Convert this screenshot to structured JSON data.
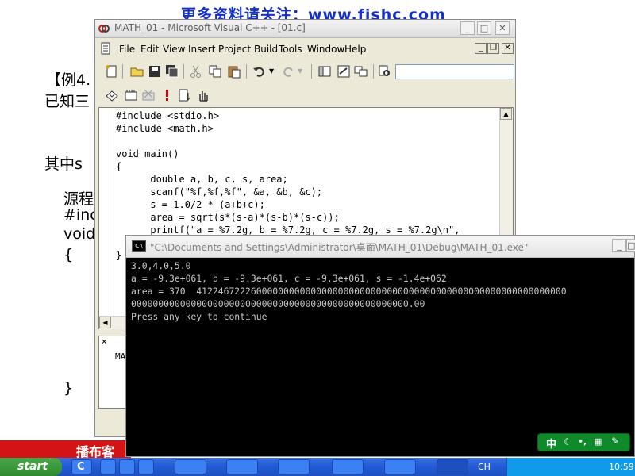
{
  "background_slide": {
    "header": "更多资料请关注：www.fishc.com",
    "lines": [
      "【例4.",
      "已知三",
      "其中s",
      "源程",
      "#incl",
      "void",
      "{",
      "}"
    ],
    "footer_label": "播布客"
  },
  "vc_window": {
    "title": "MATH_01 - Microsoft Visual C++ - [01.c]",
    "menu": [
      "File",
      "Edit",
      "View",
      "Insert",
      "Project",
      "Build",
      "Tools",
      "Window",
      "Help"
    ],
    "code": [
      "#include <stdio.h>",
      "#include <math.h>",
      "",
      "void main()",
      "{",
      "      double a, b, c, s, area;",
      "      scanf(\"%f,%f,%f\", &a, &b, &c);",
      "      s = 1.0/2 * (a+b+c);",
      "      area = sqrt(s*(s-a)*(s-b)*(s-c));",
      "      printf(\"a = %7.2g, b = %7.2g, c = %7.2g, s = %7.2g\\n\",",
      "",
      "}"
    ],
    "output_label": "MA"
  },
  "console": {
    "title": "\"C:\\Documents and Settings\\Administrator\\桌面\\MATH_01\\Debug\\MATH_01.exe\"",
    "lines": [
      "3.0,4.0,5.0",
      "a = -9.3e+061, b = -9.3e+061, c = -9.3e+061, s = -1.4e+062",
      "area = 370  41224672226000000000000000000000000000000000000000000000000000000000",
      "000000000000000000000000000000000000000000000000000.00",
      "Press any key to continue"
    ]
  },
  "ime_bar": {
    "label": "中"
  },
  "taskbar": {
    "clock": "10:59",
    "language": "CH",
    "quicklaunch_label": "C"
  },
  "colors": {
    "taskbar": "#245edb",
    "console_bg": "#000000",
    "console_text": "#c8c8c8",
    "keyword": "#0000cc",
    "header_blue": "#1530c8"
  }
}
